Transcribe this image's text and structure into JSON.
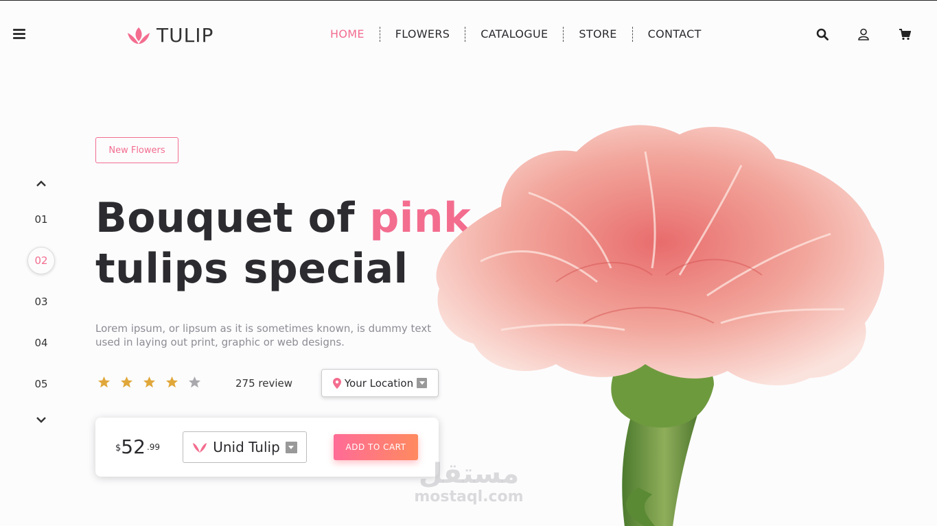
{
  "header": {
    "brand": "TULIP",
    "nav": [
      {
        "label": "HOME",
        "active": true
      },
      {
        "label": "FLOWERS",
        "active": false
      },
      {
        "label": "CATALOGUE",
        "active": false
      },
      {
        "label": "STORE",
        "active": false
      },
      {
        "label": "CONTACT",
        "active": false
      }
    ],
    "icons": [
      "search-icon",
      "user-icon",
      "cart-icon"
    ]
  },
  "slider": {
    "items": [
      "01",
      "02",
      "03",
      "04",
      "05"
    ],
    "active_index": 1
  },
  "hero": {
    "badge": "New Flowers",
    "title_line1_plain": "Bouquet of ",
    "title_line1_accent": "pink",
    "title_line2": "tulips special",
    "description": "Lorem ipsum, or lipsum as it is sometimes known, is dummy text used in laying out print, graphic or web designs.",
    "rating": 4,
    "rating_max": 5,
    "review_count": "275 review",
    "location_label": "Your Location"
  },
  "purchase": {
    "currency": "$",
    "price_int": "52",
    "price_dec": ".99",
    "variety": "Unid Tulip",
    "add_to_cart": "ADD TO CART"
  },
  "watermark": {
    "arabic": "مستقل",
    "latin": "mostaql.com"
  },
  "colors": {
    "accent": "#f36d8f",
    "star": "#e0a73a",
    "star_off": "#a9a9ad",
    "button_gradient_start": "#ff6b97",
    "button_gradient_end": "#ff8a5f"
  }
}
